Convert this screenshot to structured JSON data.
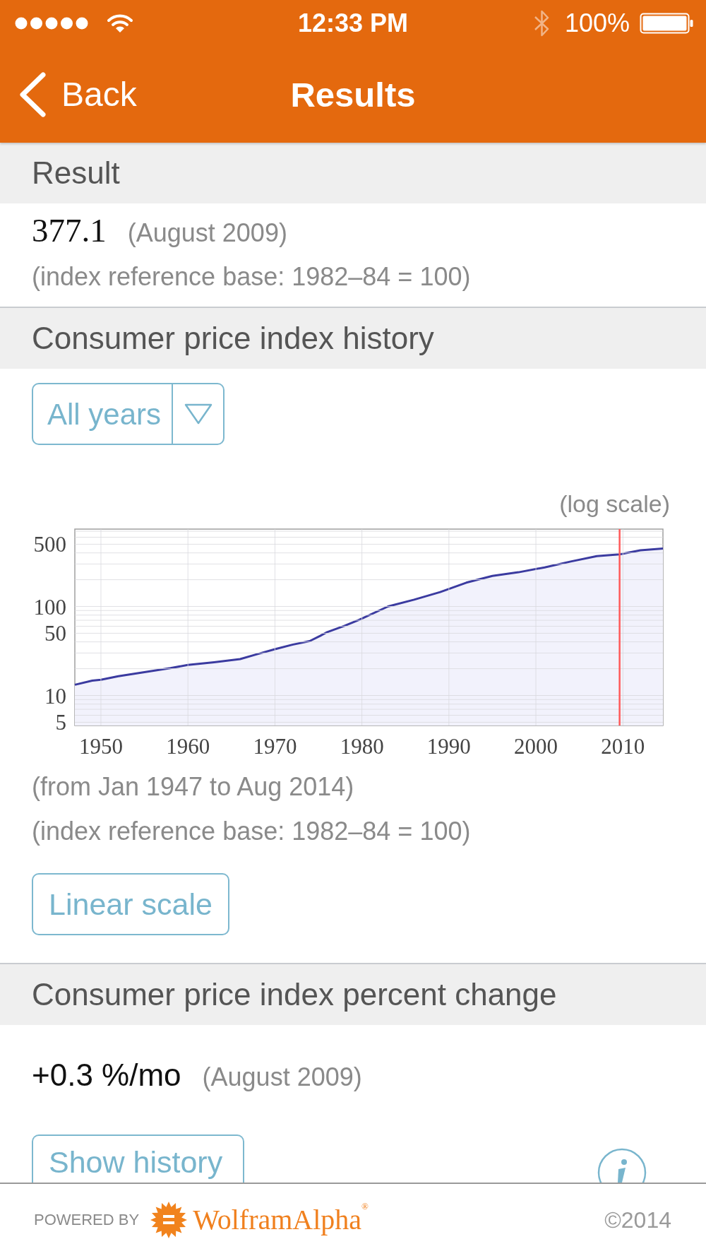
{
  "status_bar": {
    "time": "12:33 PM",
    "battery": "100%"
  },
  "nav_bar": {
    "back_label": "Back",
    "title": "Results"
  },
  "result": {
    "title": "Result",
    "value": "377.1",
    "date": "(August 2009)",
    "note": "(index reference base: 1982–84 = 100)"
  },
  "history": {
    "title": "Consumer price index history",
    "range_selector": {
      "value": "All years"
    },
    "scale_label": "(log scale)",
    "chart": {
      "y_tick_labels": [
        "500",
        "100",
        "50",
        "10",
        "5"
      ],
      "x_tick_labels": [
        "1950",
        "1960",
        "1970",
        "1980",
        "1990",
        "2000",
        "2010"
      ]
    },
    "caption": "(from Jan 1947 to Aug 2014)",
    "note": "(index reference base: 1982–84 = 100)",
    "button": "Linear scale"
  },
  "percent_change": {
    "title": "Consumer price index percent change",
    "value": "+0.3 %/mo",
    "date": "(August 2009)",
    "button": "Show history"
  },
  "footer": {
    "powered_by": "POWERED BY",
    "brand": "WolframAlpha$^{®}$",
    "copyright": "©2014"
  }
}
